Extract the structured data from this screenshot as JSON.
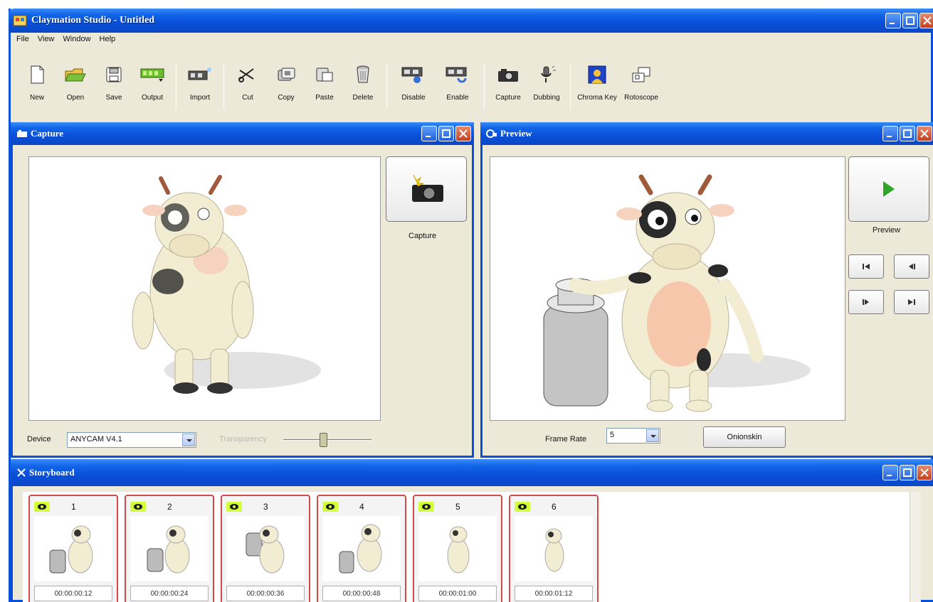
{
  "window": {
    "title": "Claymation Studio - Untitled"
  },
  "menu": {
    "items": [
      "File",
      "View",
      "Window",
      "Help"
    ]
  },
  "toolbar": {
    "buttons": [
      {
        "label": "New",
        "icon": "new-document-icon"
      },
      {
        "label": "Open",
        "icon": "open-folder-icon"
      },
      {
        "label": "Save",
        "icon": "save-icon"
      },
      {
        "label": "Output",
        "icon": "output-icon"
      },
      {
        "label": "Import",
        "icon": "import-icon"
      },
      {
        "label": "Cut",
        "icon": "scissors-icon"
      },
      {
        "label": "Copy",
        "icon": "copy-icon"
      },
      {
        "label": "Paste",
        "icon": "paste-icon"
      },
      {
        "label": "Delete",
        "icon": "trash-icon"
      },
      {
        "label": "Disable",
        "icon": "disable-icon"
      },
      {
        "label": "Enable",
        "icon": "enable-icon"
      },
      {
        "label": "Capture",
        "icon": "camera-icon"
      },
      {
        "label": "Dubbing",
        "icon": "microphone-icon"
      },
      {
        "label": "Chroma Key",
        "icon": "chroma-key-icon"
      },
      {
        "label": "Rotoscope",
        "icon": "rotoscope-icon"
      }
    ]
  },
  "capture": {
    "title": "Capture",
    "button_label": "Capture",
    "device_label": "Device",
    "device_value": "ANYCAM V4.1",
    "transparency_label": "Transparency",
    "transparency_level": 0.45
  },
  "preview": {
    "title": "Preview",
    "button_label": "Preview",
    "frame_rate_label": "Frame Rate",
    "frame_rate_value": "5",
    "onionskin_label": "Onionskin"
  },
  "storyboard": {
    "title": "Storyboard",
    "frames": [
      {
        "number": "1",
        "time": "00:00:00:12"
      },
      {
        "number": "2",
        "time": "00:00:00:24"
      },
      {
        "number": "3",
        "time": "00:00:00:36"
      },
      {
        "number": "4",
        "time": "00:00:00:48"
      },
      {
        "number": "5",
        "time": "00:00:01:00"
      },
      {
        "number": "6",
        "time": "00:00:01:12"
      }
    ]
  },
  "colors": {
    "title_bar": "#0a4fd8",
    "frame_border": "#d14b4b",
    "eye_badge": "#d2ff3a"
  }
}
